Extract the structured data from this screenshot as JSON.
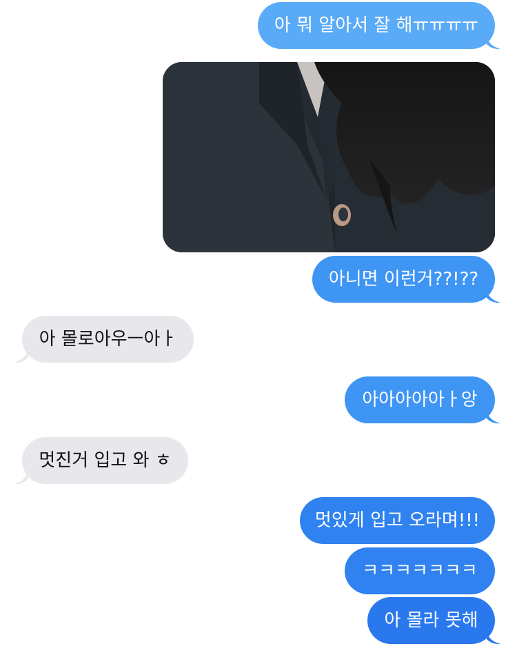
{
  "conversation": {
    "messages": [
      {
        "sender": "me",
        "text": "아 뭐 알아서 잘 해ㅠㅠㅠㅠ"
      },
      {
        "sender": "me",
        "type": "photo",
        "image": "black-jacket-photo"
      },
      {
        "sender": "me",
        "text": "아니면 이런거??!??"
      },
      {
        "sender": "them",
        "text": "아 몰로아우ㅡ아ㅏ"
      },
      {
        "sender": "me",
        "text": "아아아아아ㅏ앙"
      },
      {
        "sender": "them",
        "text": "멋진거 입고 와 ㅎ"
      },
      {
        "sender": "me",
        "text": "멋있게 입고 오라며!!!"
      },
      {
        "sender": "me",
        "text": "ㅋㅋㅋㅋㅋㅋㅋ"
      },
      {
        "sender": "me",
        "text": "아 몰라 못해"
      }
    ]
  },
  "colors": {
    "outgoing_top": "#5aabf7",
    "outgoing_mid": "#3e95f3",
    "outgoing_bottom": "#2a78ee",
    "incoming": "#e8e8ec",
    "background": "#ffffff"
  }
}
